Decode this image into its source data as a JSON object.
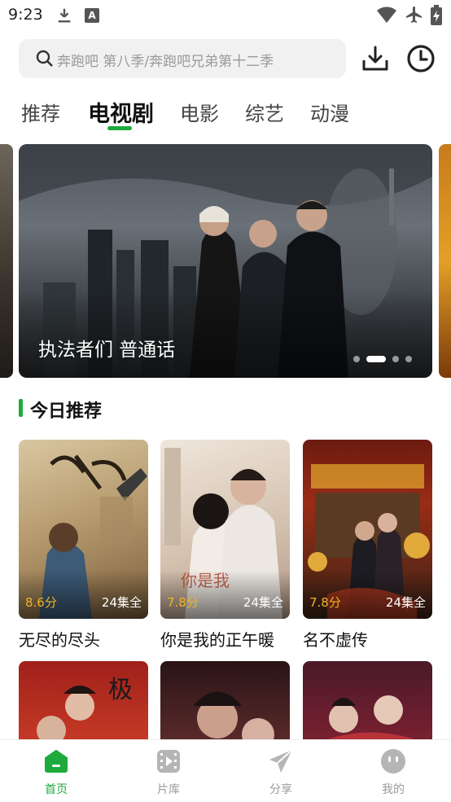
{
  "status_bar": {
    "time": "9:23",
    "notif_letter": "A"
  },
  "search": {
    "placeholder": "奔跑吧 第八季/奔跑吧兄弟第十二季"
  },
  "tabs": [
    {
      "label": "推荐",
      "active": false
    },
    {
      "label": "电视剧",
      "active": true
    },
    {
      "label": "电影",
      "active": false
    },
    {
      "label": "综艺",
      "active": false
    },
    {
      "label": "动漫",
      "active": false
    }
  ],
  "banner": {
    "title": "执法者们 普通话",
    "dots": 4,
    "active_dot": 1
  },
  "section": {
    "title": "今日推荐"
  },
  "cards": [
    {
      "name": "无尽的尽头",
      "score": "8.6分",
      "episodes": "24集全"
    },
    {
      "name": "你是我的正午暖",
      "score": "7.8分",
      "episodes": "24集全"
    },
    {
      "name": "名不虚传",
      "score": "7.8分",
      "episodes": "24集全"
    }
  ],
  "nav": [
    {
      "label": "首页",
      "icon": "home-icon",
      "active": true
    },
    {
      "label": "片库",
      "icon": "film-library-icon",
      "active": false
    },
    {
      "label": "分享",
      "icon": "share-icon",
      "active": false
    },
    {
      "label": "我的",
      "icon": "profile-icon",
      "active": false
    }
  ],
  "colors": {
    "accent": "#1eaa3c",
    "score": "#f2b224"
  }
}
